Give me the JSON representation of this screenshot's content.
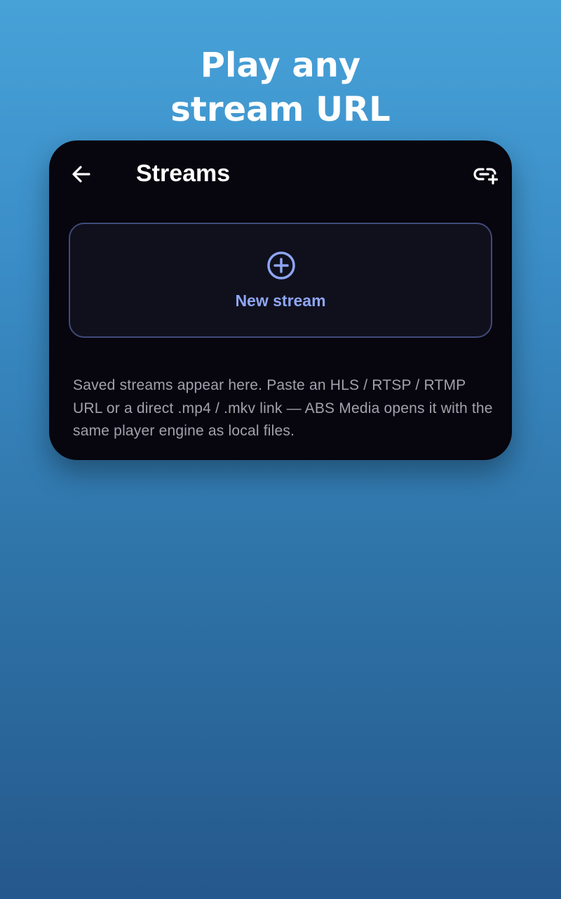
{
  "headline": {
    "line1": "Play any",
    "line2": "stream URL"
  },
  "app_bar": {
    "back_icon": "arrow-left-icon",
    "title": "Streams",
    "action_icon": "link-add-icon"
  },
  "new_stream": {
    "icon": "plus-circle-icon",
    "label": "New stream"
  },
  "empty_hint": "Saved streams appear here. Paste an HLS / RTSP / RTMP URL or a direct .mp4 / .mkv link — ABS Media opens it with the same player engine as local files.",
  "colors": {
    "card_background": "#07050d",
    "accent": "#8ea6f2",
    "button_border": "#404b7a",
    "hint_text": "#a3a1ad",
    "headline_text": "#ffffff"
  }
}
